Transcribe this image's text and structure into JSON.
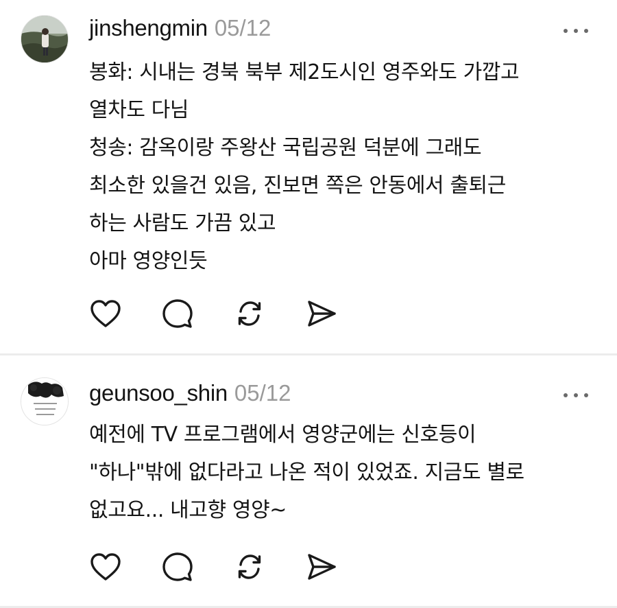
{
  "posts": [
    {
      "username": "jinshengmin",
      "date": "05/12",
      "avatar_icon": "avatar-photo",
      "lines": [
        "봉화: 시내는 경북 북부 제2도시인 영주와도 가깝고",
        "열차도 다님",
        "청송: 감옥이랑 주왕산 국립공원 덕분에 그래도",
        "최소한 있을건 있음, 진보면 쪽은 안동에서 출퇴근",
        "하는 사람도 가끔 있고",
        "아마 영양인듯"
      ],
      "actions": [
        "heart-icon",
        "comment-icon",
        "repost-icon",
        "send-icon"
      ]
    },
    {
      "username": "geunsoo_shin",
      "date": "05/12",
      "avatar_icon": "avatar-photo",
      "lines": [
        "예전에 TV 프로그램에서 영양군에는 신호등이",
        "\"하나\"밖에 없다라고 나온 적이 있었죠. 지금도 별로",
        "없고요... 내고향 영양~"
      ],
      "actions": [
        "heart-icon",
        "comment-icon",
        "repost-icon",
        "send-icon"
      ]
    }
  ],
  "colors": {
    "text": "#141414",
    "muted": "#9a9a9a",
    "icon": "#1a1a1a",
    "divider": "#ececec"
  }
}
